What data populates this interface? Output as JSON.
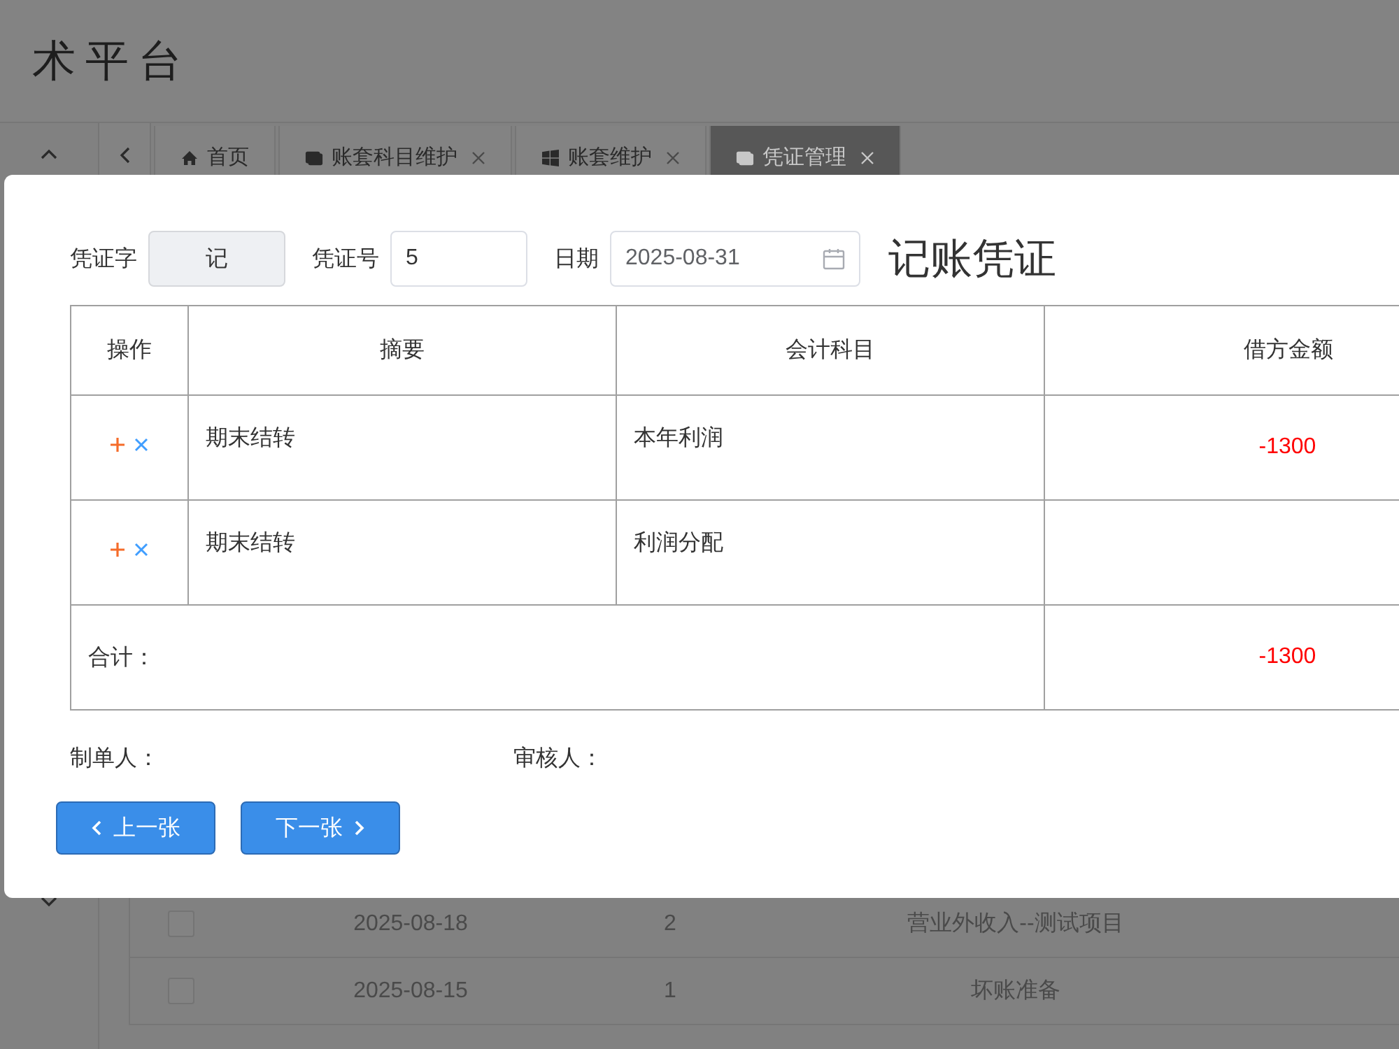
{
  "header": {
    "title": "术平台"
  },
  "tabs": [
    {
      "label": "首页",
      "kind": "home",
      "closable": false,
      "selected": false
    },
    {
      "label": "账套科目维护",
      "kind": "window",
      "closable": true,
      "selected": false
    },
    {
      "label": "账套维护",
      "kind": "grid",
      "closable": true,
      "selected": false
    },
    {
      "label": "凭证管理",
      "kind": "window",
      "closable": true,
      "selected": true
    }
  ],
  "background_table": {
    "rows": [
      {
        "checked": false,
        "date": "2025-08-18",
        "number": "2",
        "subject": "营业外收入--测试项目"
      },
      {
        "checked": false,
        "date": "2025-08-15",
        "number": "1",
        "subject": "坏账准备"
      }
    ]
  },
  "dialog": {
    "fields": [
      {
        "label": "凭证字",
        "value": "记",
        "kind": "text",
        "disabled": true
      },
      {
        "label": "凭证号",
        "value": "5",
        "kind": "text",
        "disabled": false
      },
      {
        "label": "日期",
        "value": "2025-08-31",
        "kind": "date",
        "disabled": false
      }
    ],
    "title": "记账凭证",
    "table": {
      "columns": [
        "操作",
        "摘要",
        "会计科目",
        "借方金额"
      ],
      "rows": [
        {
          "summary": "期末结转",
          "account": "本年利润",
          "debit": "-1300"
        },
        {
          "summary": "期末结转",
          "account": "利润分配"
        }
      ],
      "total": {
        "label": "合计：",
        "debit": "-1300"
      }
    },
    "signatures": [
      "制单人：",
      "审核人："
    ],
    "buttons": [
      {
        "label": "上一张",
        "kind": "prev"
      },
      {
        "label": "下一张",
        "kind": "next"
      }
    ]
  }
}
